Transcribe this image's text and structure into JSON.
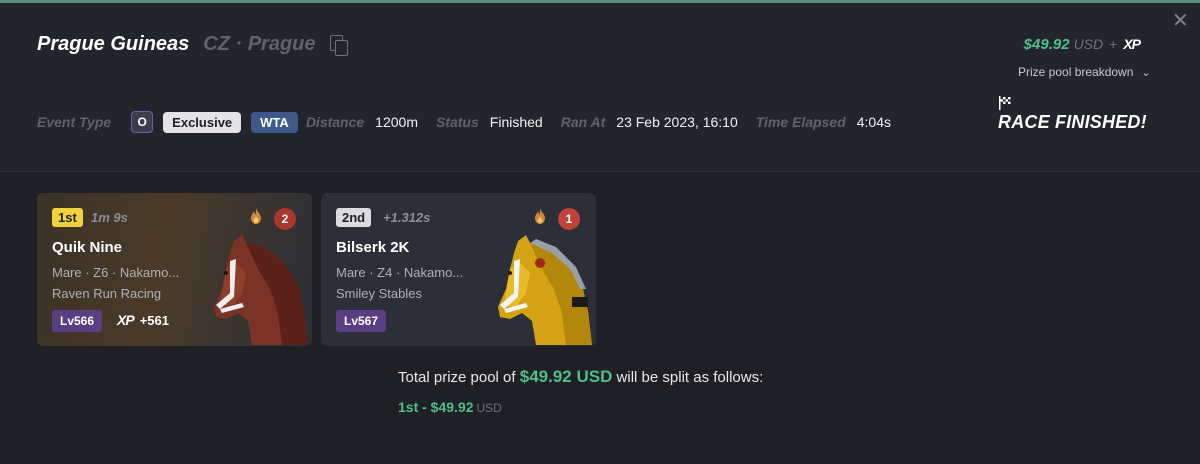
{
  "race": {
    "name": "Prague Guineas",
    "location": "CZ · Prague"
  },
  "prize": {
    "amount": "$49.92",
    "currency": "USD",
    "plus": "+",
    "xp_label": "XP",
    "breakdown_label": "Prize pool breakdown"
  },
  "meta": {
    "event_type_label": "Event Type",
    "class_badge": "O",
    "exclusive_badge": "Exclusive",
    "wta_badge": "WTA",
    "distance_label": "Distance",
    "distance_value": "1200m",
    "status_label": "Status",
    "status_value": "Finished",
    "ran_at_label": "Ran At",
    "ran_at_value": "23 Feb 2023, 16:10",
    "time_elapsed_label": "Time Elapsed",
    "time_elapsed_value": "4:04s"
  },
  "finished_text": "RACE FINISHED!",
  "results": [
    {
      "position": "1st",
      "time": "1m 9s",
      "rank": "2",
      "name": "Quik Nine",
      "info": "Mare · Z6 · Nakamo...",
      "stable": "Raven Run Racing",
      "level": "Lv566",
      "xp_label": "XP",
      "xp_value": "+561"
    },
    {
      "position": "2nd",
      "time": "+1.312s",
      "rank": "1",
      "name": "Bilserk 2K",
      "info": "Mare · Z4 · Nakamo...",
      "stable": "Smiley Stables",
      "level": "Lv567"
    }
  ],
  "split": {
    "prefix": "Total prize pool of",
    "amount": "$49.92 USD",
    "suffix": "will be split as follows:",
    "lines": [
      {
        "place": "1st - $49.92",
        "currency": "USD"
      }
    ]
  },
  "colors": {
    "accent_green": "#4fbf89",
    "first_badge": "#f2d23a",
    "level_badge": "#5a3e83",
    "rank_circle": "#a8372e"
  }
}
